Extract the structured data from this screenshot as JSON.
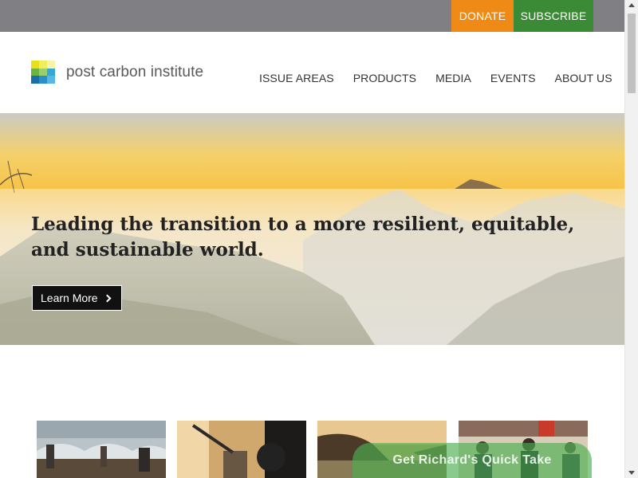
{
  "topbar": {
    "donate_label": "DONATE",
    "subscribe_label": "SUBSCRIBE",
    "colors": {
      "bar": "#7f7f84",
      "donate": "#ee8a15",
      "subscribe": "#3b8b36"
    }
  },
  "header": {
    "logo_text": "post carbon institute",
    "nav": [
      "ISSUE AREAS",
      "PRODUCTS",
      "MEDIA",
      "EVENTS",
      "ABOUT US"
    ]
  },
  "hero": {
    "heading": "Leading the transition to a more resilient, equitable, and sustainable world.",
    "button_label": "Learn More",
    "button_icon": "chevron-right-icon"
  },
  "cards": [
    {
      "image": "community-garden-photo"
    },
    {
      "image": "podcast-microphone-photo"
    },
    {
      "image": "sunset-landscape-photo"
    },
    {
      "image": "group-event-photo"
    }
  ],
  "floating_cta": {
    "label": "Get Richard's Quick Take",
    "color": "#4caf50"
  }
}
